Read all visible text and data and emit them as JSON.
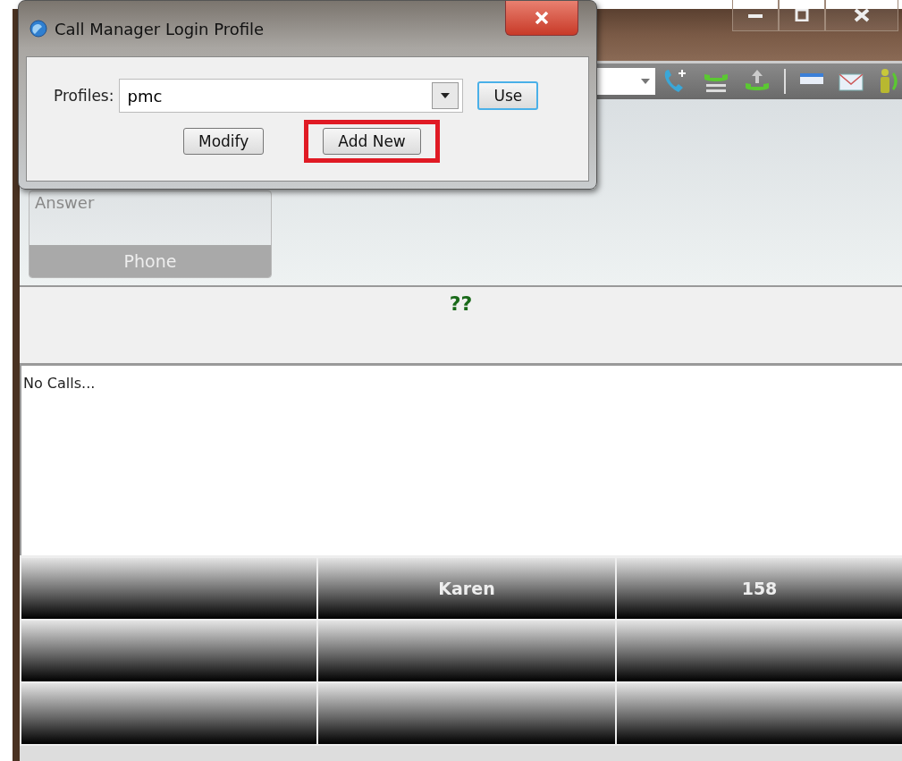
{
  "main_window": {
    "answer_tile": {
      "label": "Answer",
      "footer": "Phone"
    },
    "status_text": "??",
    "calls_list": {
      "empty_text": "No Calls..."
    },
    "speed_dial_rows": [
      {
        "cells": [
          null,
          "Karen",
          "158"
        ]
      },
      {
        "cells": [
          null,
          null,
          null
        ]
      },
      {
        "cells": [
          null,
          null,
          null
        ]
      }
    ]
  },
  "dialog": {
    "title": "Call Manager Login Profile",
    "profiles_label": "Profiles:",
    "profile_value": "pmc",
    "use_button": {
      "label": "Use",
      "focused": true
    },
    "buttons": [
      {
        "label": "Modify",
        "highlighted": false
      },
      {
        "label": "Add New",
        "highlighted": true
      }
    ]
  }
}
